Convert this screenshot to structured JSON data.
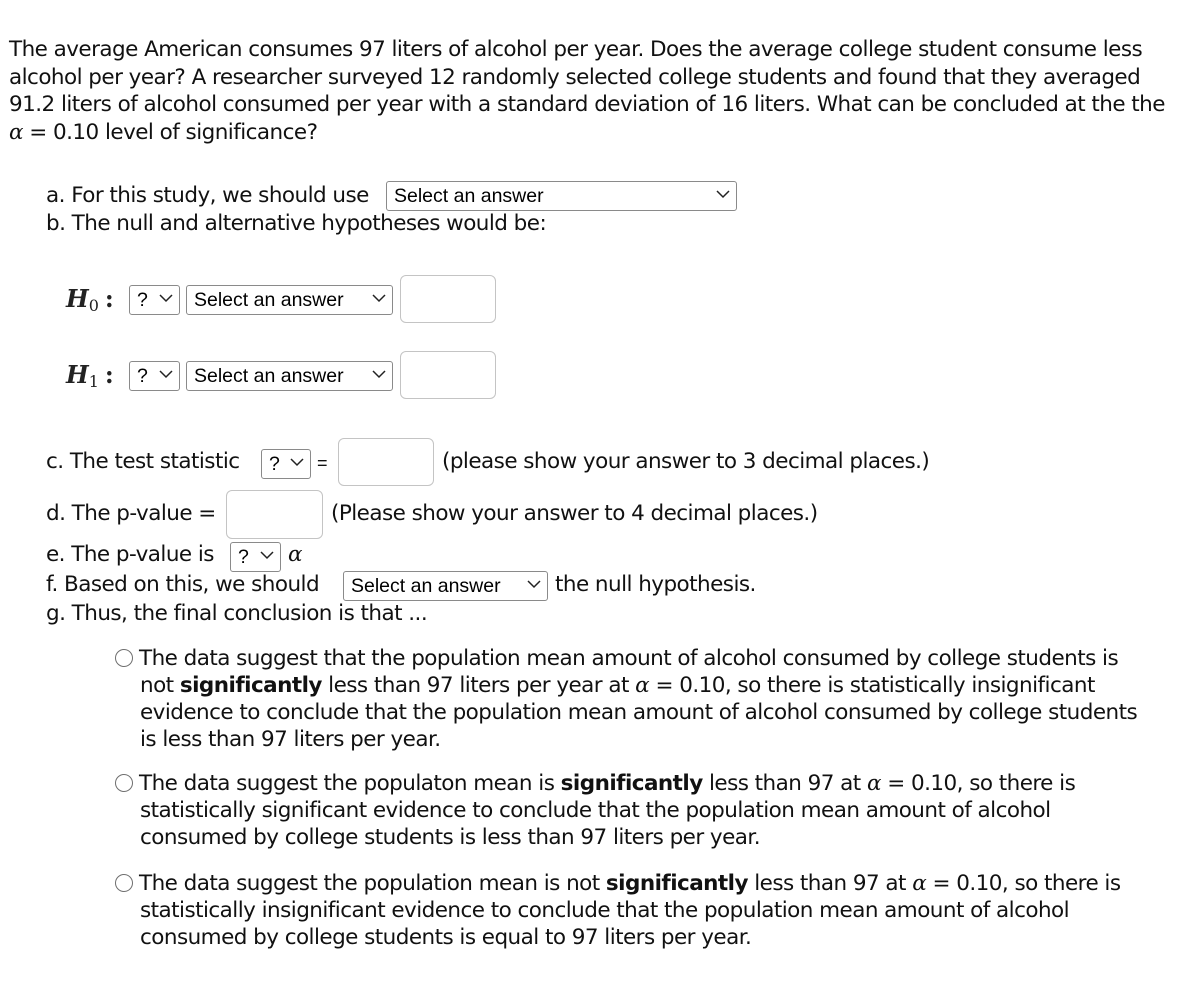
{
  "question": {
    "prompt_part1": "The average American consumes 97 liters of alcohol per year. Does the average college student consume less alcohol per year? A researcher surveyed 12 randomly selected college students and found that they averaged 91.2 liters of alcohol consumed per year with a standard deviation of 16 liters. What can be concluded at the the ",
    "alpha_symbol": "α",
    "prompt_part2": " = 0.10 level of significance?"
  },
  "part_a": {
    "label": "a. For this study, we should use",
    "select_value": "Select an answer"
  },
  "part_b": {
    "label": "b. The null and alternative hypotheses would be:",
    "h0": {
      "symbol": "H",
      "subscript": "0",
      "colon": ":",
      "operator_value": "?",
      "parameter_value": "Select an answer",
      "input_value": ""
    },
    "h1": {
      "symbol": "H",
      "subscript": "1",
      "colon": ":",
      "operator_value": "?",
      "parameter_value": "Select an answer",
      "input_value": ""
    }
  },
  "part_c": {
    "label": "c. The test statistic",
    "select_value": "?",
    "equals": "=",
    "input_value": "",
    "hint": "(please show your answer to 3 decimal places.)"
  },
  "part_d": {
    "label": "d. The p-value =",
    "input_value": "",
    "hint": "(Please show your answer to 4 decimal places.)"
  },
  "part_e": {
    "label": "e. The p-value is",
    "select_value": "?",
    "alpha_symbol": "α"
  },
  "part_f": {
    "label": "f. Based on this, we should",
    "select_value": "Select an answer",
    "suffix": "the null hypothesis."
  },
  "part_g": {
    "label": "g. Thus, the final conclusion is that ...",
    "options": [
      {
        "pre": "The data suggest that the population mean amount of alcohol consumed by college students is not ",
        "bold": "significantly",
        "mid": " less than 97 liters per year at ",
        "alpha": "α",
        "post": " = 0.10, so there is statistically insignificant evidence to conclude that the population mean amount of alcohol consumed by college students is less than 97 liters per year.",
        "selected": false
      },
      {
        "pre": "The data suggest the populaton mean is ",
        "bold": "significantly",
        "mid": " less than 97 at ",
        "alpha": "α",
        "post": " = 0.10, so there is statistically significant evidence to conclude that the population mean amount of alcohol consumed by college students is less than 97 liters per year.",
        "selected": false
      },
      {
        "pre": "The data suggest the population mean is not ",
        "bold": "significantly",
        "mid": " less than 97 at ",
        "alpha": "α",
        "post": " = 0.10, so there is statistically insignificant evidence to conclude that the population mean amount of alcohol consumed by college students is equal to 97 liters per year.",
        "selected": false
      }
    ]
  }
}
